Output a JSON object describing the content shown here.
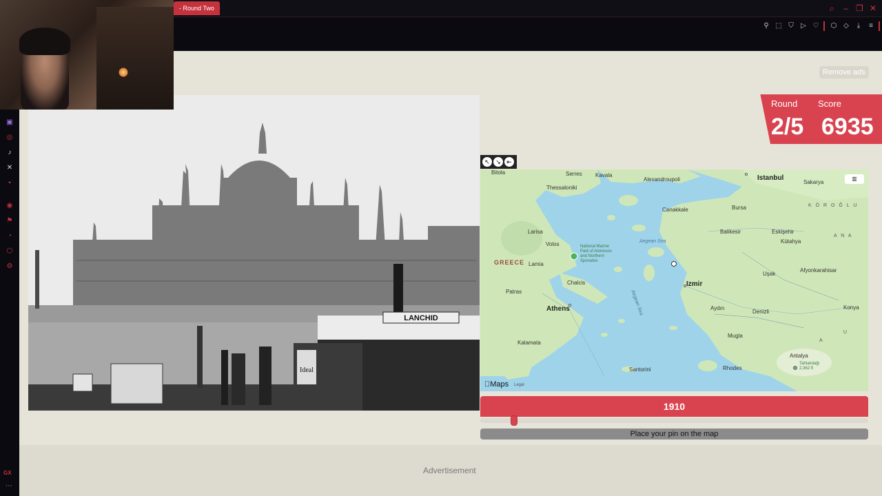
{
  "browser": {
    "tab_title": "- Round Two",
    "new_tab": "+",
    "window_controls": [
      "⌕",
      "–",
      "❐",
      "✕"
    ]
  },
  "ads": {
    "remove_label": "Remove ads",
    "advertisement_label": "Advertisement"
  },
  "score": {
    "round_label": "Round",
    "score_label": "Score",
    "round_value": "2/5",
    "score_value": "6935"
  },
  "photo": {
    "sign_lanchid": "LANCHID",
    "sign_ideal": "Ideal"
  },
  "map": {
    "provider": "Maps",
    "legal": "Legal",
    "controls": [
      "↖",
      "↘",
      "⇤"
    ],
    "labels": {
      "bitola": "Bitola",
      "serres": "Serres",
      "kavala": "Kavala",
      "alexandroupoli": "Alexandroupoli",
      "istanbul": "Istanbul",
      "sakarya": "Sakarya",
      "thessaloniki": "Thessaloniki",
      "canakkale": "Canakkale",
      "bursa": "Bursa",
      "koroglu": "K Ö R O Ğ L U",
      "larisa": "Larisa",
      "balikesir": "Balikesir",
      "eskisehir": "Eskişehir",
      "volos": "Volos",
      "park": "National Marine Park of Alonissos and Northern Sporades",
      "aegean_sea": "Aegean Sea",
      "kutahya": "Kütahya",
      "greece": "GREECE",
      "lamia": "Lamia",
      "afyon": "Afyonkarahisar",
      "chalcis": "Chalcis",
      "izmir": "Izmir",
      "usak": "Uşak",
      "patras": "Patras",
      "athens": "Athens",
      "aydin": "Aydın",
      "denizli": "Denizli",
      "konya": "Konya",
      "mugla": "Mugla",
      "kalamata": "Kalamata",
      "antalya": "Antalya",
      "rhodes": "Rhodes",
      "santorini": "Santorini",
      "tahtali": "Tahtalıdağı 2,362 ft",
      "aegean_sea2": "Aegean Sea",
      "ana": "A N A",
      "a": "A",
      "u": "U"
    }
  },
  "guess": {
    "year": "1910",
    "year_fraction": 0.03,
    "place_label": "Place your pin on the map"
  },
  "colors": {
    "accent": "#d9434f",
    "page_bg": "#e6e4d8",
    "sea": "#9fd3ea",
    "land": "#cfe7b8"
  }
}
